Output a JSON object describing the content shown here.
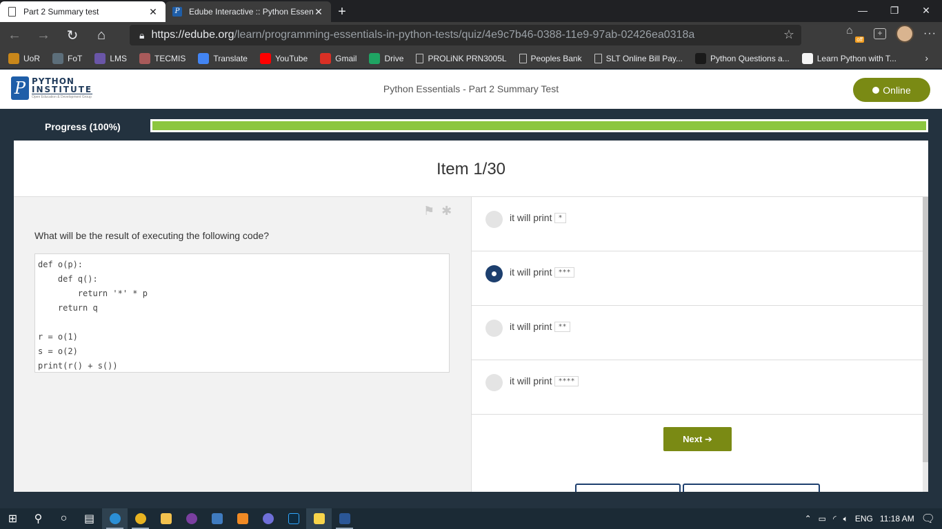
{
  "browser": {
    "tabs": [
      {
        "title": "Part 2 Summary test",
        "active": false
      },
      {
        "title": "Edube Interactive :: Python Essen",
        "active": true
      }
    ],
    "url_scheme": "https://",
    "url_host": "edube.org",
    "url_path": "/learn/programming-essentials-in-python-tests/quiz/4e9c7b46-0388-11e9-97ab-02426ea0318a",
    "off_badge": "off",
    "bookmarks": [
      {
        "label": "UoR",
        "icon": "uor-icon",
        "color": "#c9871a"
      },
      {
        "label": "FoT",
        "icon": "fot-icon",
        "color": "#5c6e7a"
      },
      {
        "label": "LMS",
        "icon": "lms-icon",
        "color": "#6a56a8"
      },
      {
        "label": "TECMIS",
        "icon": "tecmis-icon",
        "color": "#a85a5a"
      },
      {
        "label": "Translate",
        "icon": "translate-icon",
        "color": "#4285f4"
      },
      {
        "label": "YouTube",
        "icon": "youtube-icon",
        "color": "#ff0000"
      },
      {
        "label": "Gmail",
        "icon": "gmail-icon",
        "color": "#d93025"
      },
      {
        "label": "Drive",
        "icon": "drive-icon",
        "color": "#1fa463"
      },
      {
        "label": "PROLiNK PRN3005L",
        "icon": "document-icon",
        "color": ""
      },
      {
        "label": "Peoples Bank",
        "icon": "document-icon",
        "color": ""
      },
      {
        "label": "SLT Online Bill Pay...",
        "icon": "document-icon",
        "color": ""
      },
      {
        "label": "Python Questions a...",
        "icon": "sf-icon",
        "color": "#1a1a1a"
      },
      {
        "label": "Learn Python with T...",
        "icon": "learn-python-icon",
        "color": "#f5f5f5"
      }
    ]
  },
  "app": {
    "logo_line1": "PYTHON",
    "logo_line2": "INSTITUTE",
    "logo_line3": "Open Education & Development Group",
    "title": "Python Essentials - Part 2 Summary Test",
    "status": "Online"
  },
  "progress": {
    "label": "Progress (100%)",
    "value": 1.0
  },
  "quiz": {
    "item_label": "Item 1/30",
    "question": "What will be the result of executing the following code?",
    "code": "def o(p):\n    def q():\n        return '*' * p\n    return q\n\nr = o(1)\ns = o(2)\nprint(r() + s())",
    "options": [
      {
        "prefix": "it will print",
        "code": "*",
        "selected": false
      },
      {
        "prefix": "it will print",
        "code": "***",
        "selected": true
      },
      {
        "prefix": "it will print",
        "code": "**",
        "selected": false
      },
      {
        "prefix": "it will print",
        "code": "****",
        "selected": false
      }
    ],
    "next_label": "Next ➔"
  },
  "taskbar": {
    "language": "ENG",
    "time": "11:18 AM"
  }
}
